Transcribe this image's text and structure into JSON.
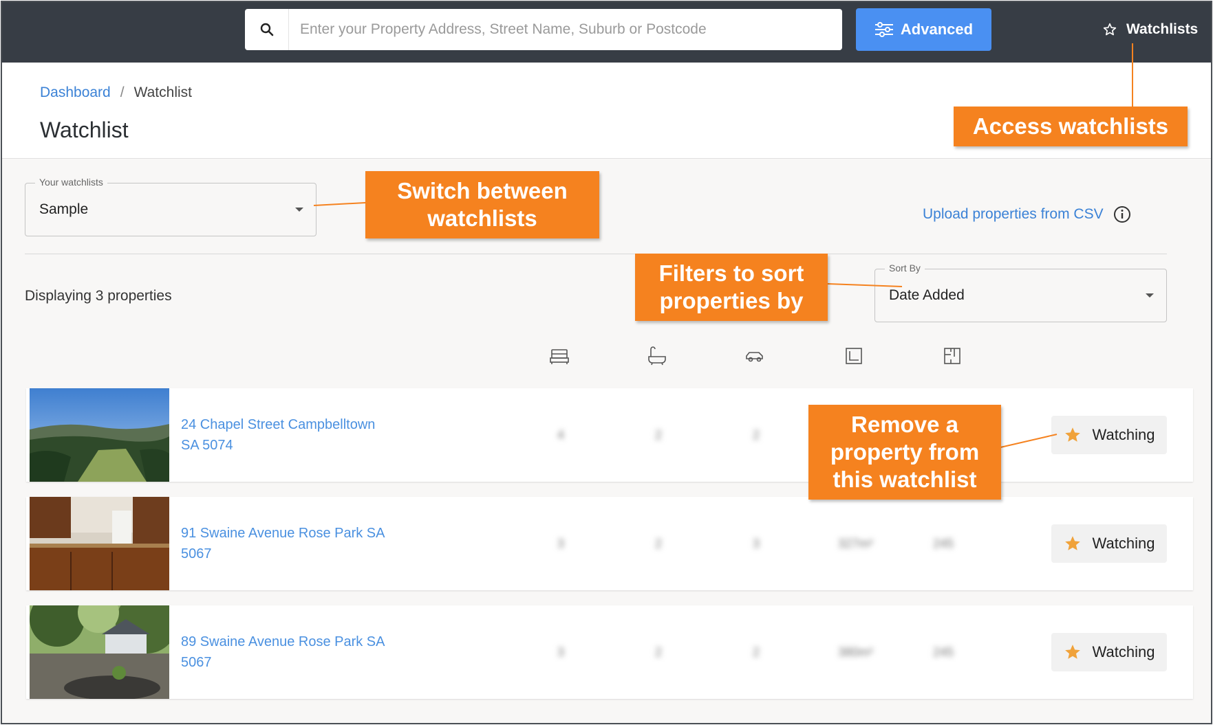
{
  "topbar": {
    "search_placeholder": "Enter your Property Address, Street Name, Suburb or Postcode",
    "advanced_label": "Advanced",
    "watchlists_label": "Watchlists"
  },
  "breadcrumb": {
    "dashboard": "Dashboard",
    "separator": "/",
    "current": "Watchlist"
  },
  "page_title": "Watchlist",
  "watchlist_select": {
    "legend": "Your watchlists",
    "value": "Sample"
  },
  "upload_csv_label": "Upload properties from CSV",
  "display_count": "Displaying 3 properties",
  "sort": {
    "legend": "Sort By",
    "value": "Date Added"
  },
  "feature_icons": [
    "bed-icon",
    "bath-icon",
    "car-icon",
    "land-size-icon",
    "floor-plan-icon"
  ],
  "properties": [
    {
      "address_line1": "24 Chapel Street Campbelltown",
      "address_line2": "SA 5074",
      "values": [
        "4",
        "2",
        "2"
      ],
      "watch_label": "Watching"
    },
    {
      "address_line1": "91 Swaine Avenue Rose Park SA",
      "address_line2": "5067",
      "values": [
        "3",
        "2",
        "3",
        "327m²",
        "245"
      ],
      "watch_label": "Watching"
    },
    {
      "address_line1": "89 Swaine Avenue Rose Park SA",
      "address_line2": "5067",
      "values": [
        "3",
        "2",
        "2",
        "380m²",
        "245"
      ],
      "watch_label": "Watching"
    }
  ],
  "annotations": {
    "access": "Access watchlists",
    "switch_1": "Switch between",
    "switch_2": "watchlists",
    "filters_1": "Filters to sort",
    "filters_2": "properties by",
    "remove_1": "Remove a",
    "remove_2": "property from",
    "remove_3": "this watchlist"
  },
  "colors": {
    "topbar": "#373d45",
    "accent_blue": "#4a90f2",
    "link_blue": "#3b82d6",
    "callout_orange": "#f5821f",
    "star_orange": "#f0a23a"
  }
}
